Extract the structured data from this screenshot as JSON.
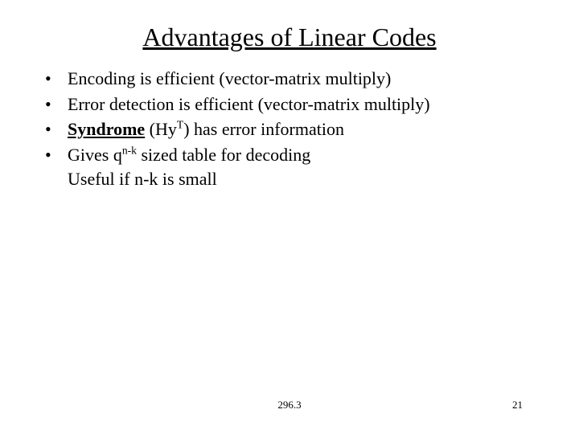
{
  "title": "Advantages of Linear Codes",
  "bullets": {
    "b1": "Encoding is efficient (vector-matrix multiply)",
    "b2": "Error detection is efficient (vector-matrix multiply)",
    "b3_strong": "Syndrome",
    "b3_rest_a": " (Hy",
    "b3_sup": "T",
    "b3_rest_b": ") has error information",
    "b4_a": "Gives q",
    "b4_sup": "n-k",
    "b4_b": " sized table for decoding",
    "b4_line2": "Useful if n-k is small"
  },
  "footer": {
    "center": "296.3",
    "right": "21"
  },
  "dot": "•"
}
